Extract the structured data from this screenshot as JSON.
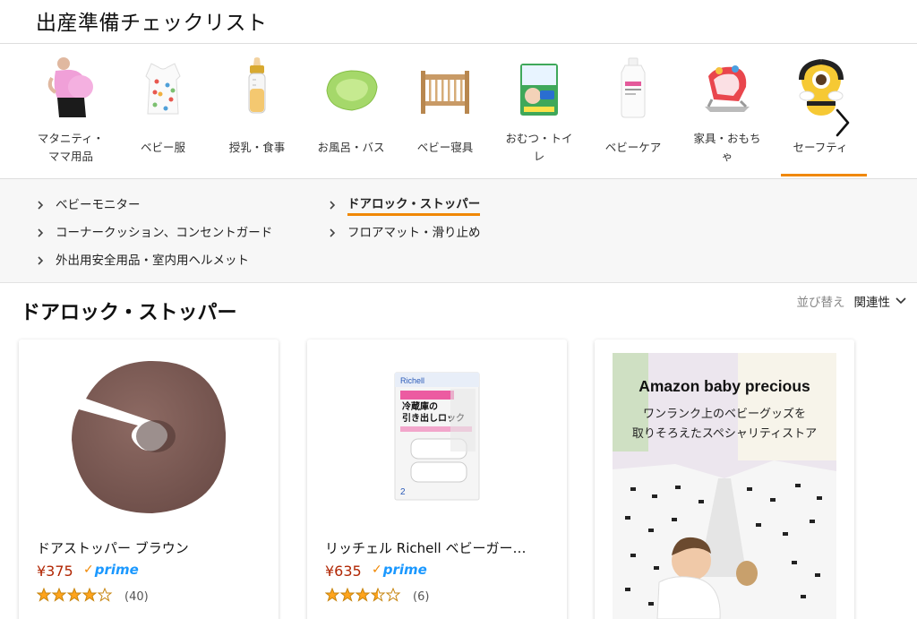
{
  "header": {
    "title": "出産準備チェックリスト"
  },
  "categories": [
    {
      "label": "マタニティ・ママ用品",
      "icon": "maternity-icon"
    },
    {
      "label": "ベビー服",
      "icon": "baby-clothes-icon"
    },
    {
      "label": "授乳・食事",
      "icon": "baby-bottle-icon"
    },
    {
      "label": "お風呂・バス",
      "icon": "baby-bath-icon"
    },
    {
      "label": "ベビー寝具",
      "icon": "crib-icon"
    },
    {
      "label": "おむつ・トイレ",
      "icon": "diaper-icon"
    },
    {
      "label": "ベビーケア",
      "icon": "lotion-icon"
    },
    {
      "label": "家具・おもちゃ",
      "icon": "bouncer-icon"
    },
    {
      "label": "セーフティ",
      "icon": "bee-cushion-icon",
      "active": true
    }
  ],
  "subcategories": {
    "col1": [
      "ベビーモニター",
      "コーナークッション、コンセントガード",
      "外出用安全用品・室内用ヘルメット"
    ],
    "col2": [
      "ドアロック・ストッパー",
      "フロアマット・滑り止め"
    ],
    "active": "ドアロック・ストッパー"
  },
  "results": {
    "title": "ドアロック・ストッパー",
    "sort_label": "並び替え",
    "sort_value": "関連性"
  },
  "products": [
    {
      "title": "ドアストッパー ブラウン",
      "price": "¥375",
      "prime": "prime",
      "rating": 4.0,
      "reviews": "(40)",
      "image_icon": "door-stopper-image"
    },
    {
      "title": "リッチェル Richell ベビーガー…",
      "price": "¥635",
      "prime": "prime",
      "rating": 3.5,
      "reviews": "(6)",
      "image_icon": "drawer-lock-package-image",
      "package": {
        "brand": "Richell",
        "line1": "冷蔵庫の",
        "line2": "引き出しロック",
        "count": "2"
      }
    }
  ],
  "promo": {
    "title": "Amazon baby precious",
    "line1": "ワンランク上のベビーグッズを",
    "line2": "取りそろえたスペシャリティストア"
  },
  "colors": {
    "accent": "#f08804",
    "price": "#b12704",
    "prime": "#1a98ff",
    "star": "#ffa41c"
  }
}
